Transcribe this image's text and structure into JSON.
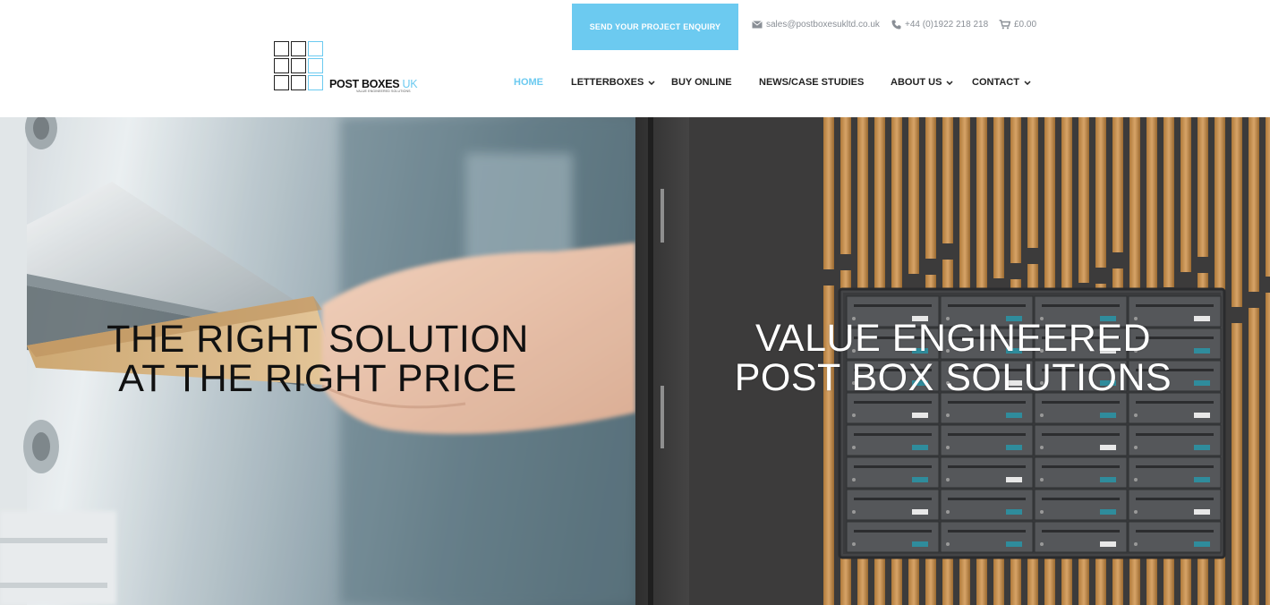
{
  "header": {
    "cta_label": "SEND YOUR PROJECT ENQUIRY",
    "email": "sales@postboxesukltd.co.uk",
    "phone": "+44 (0)1922 218 218",
    "cart_total": "£0.00",
    "icons": {
      "email": "envelope-icon",
      "phone": "phone-icon",
      "cart": "cart-icon"
    }
  },
  "logo": {
    "brand": "POST BOXES",
    "brand_suffix": "UK",
    "tagline": "VALUE ENGINEERED SOLUTIONS"
  },
  "nav": {
    "items": [
      {
        "label": "HOME",
        "active": true,
        "dropdown": false
      },
      {
        "label": "LETTERBOXES",
        "active": false,
        "dropdown": true
      },
      {
        "label": "BUY ONLINE",
        "active": false,
        "dropdown": false
      },
      {
        "label": "NEWS/CASE STUDIES",
        "active": false,
        "dropdown": false
      },
      {
        "label": "ABOUT US",
        "active": false,
        "dropdown": true
      },
      {
        "label": "CONTACT",
        "active": false,
        "dropdown": true
      }
    ]
  },
  "hero": {
    "left": {
      "line1": "THE RIGHT SOLUTION",
      "line2": "AT THE RIGHT PRICE"
    },
    "right": {
      "line1": "VALUE ENGINEERED",
      "line2": "POST BOX SOLUTIONS"
    }
  },
  "colors": {
    "accent": "#6ccaf0",
    "nav_text": "#222222",
    "muted": "#8a8f96"
  }
}
